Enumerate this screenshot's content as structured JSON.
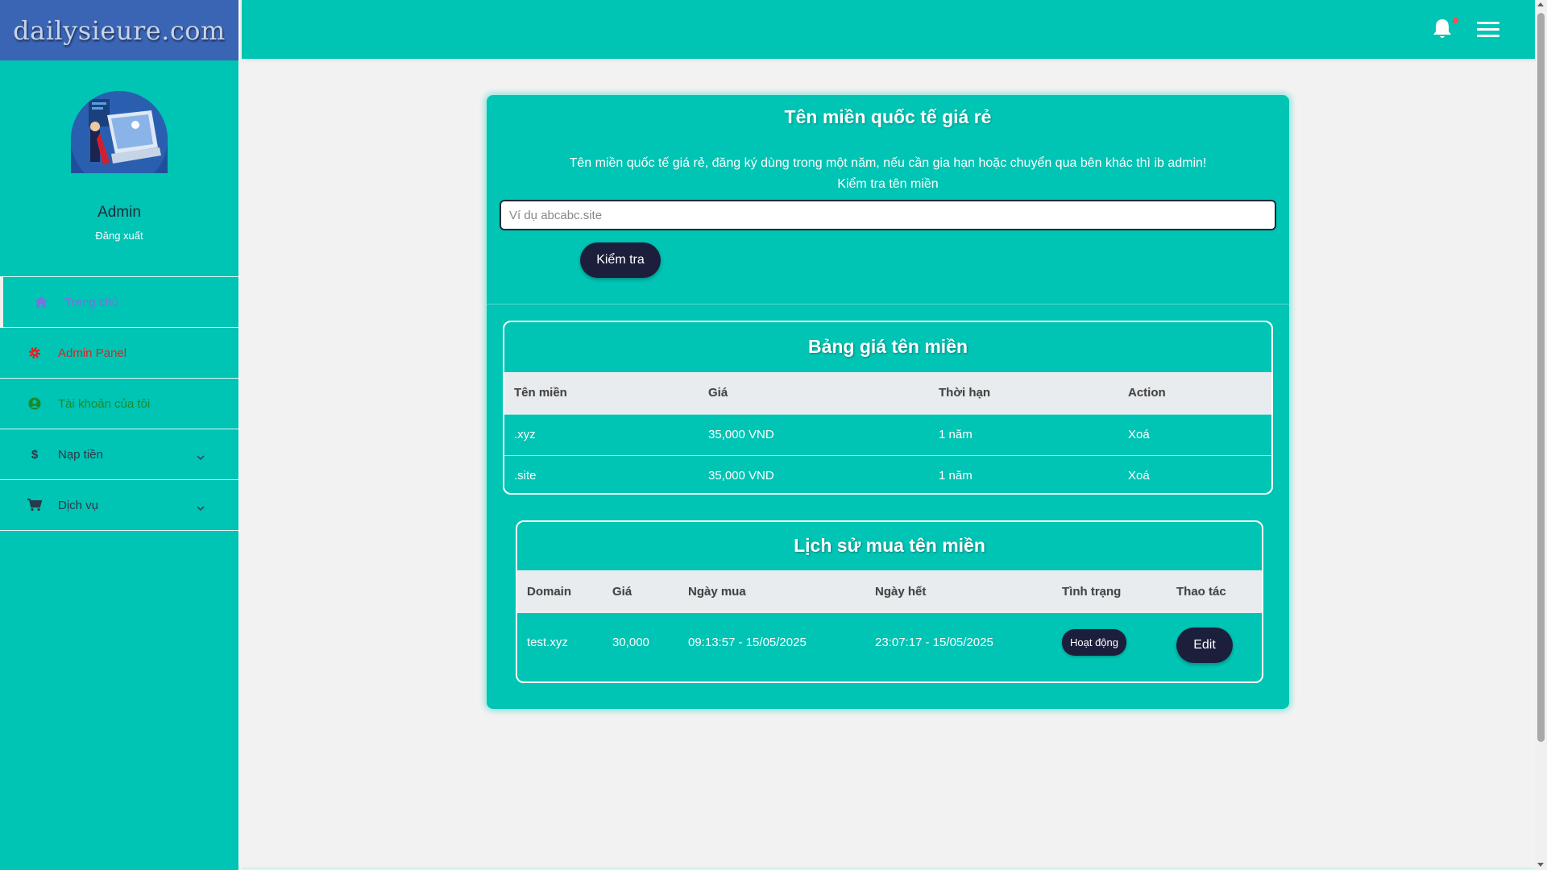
{
  "brand": {
    "name": "dailysieure.com"
  },
  "profile": {
    "name": "Admin",
    "logout_label": "Đăng xuất"
  },
  "sidebar": {
    "items": [
      {
        "label": "Trang chủ",
        "icon": "home-icon",
        "color": "#7c6fe0"
      },
      {
        "label": "Admin Panel",
        "icon": "gear-icon",
        "color": "#e02020"
      },
      {
        "label": "Tài khoản của tôi",
        "icon": "user-circle-icon",
        "color": "#1c8a2a"
      },
      {
        "label": "Nạp tiền",
        "icon": "dollar-icon",
        "color": "#2a3a4a"
      },
      {
        "label": "Dịch vụ",
        "icon": "cart-icon",
        "color": "#2a3a4a"
      }
    ]
  },
  "topbar": {
    "icons": [
      "bell-icon",
      "menu-icon"
    ]
  },
  "main": {
    "title": "Tên miền quốc tế giá rẻ",
    "description": "Tên miền quốc tế giá rẻ, đăng ký dùng trong một năm, nếu cần gia hạn hoặc chuyển qua bên khác thì ib admin!",
    "check_label": "Kiểm tra tên miền",
    "search_placeholder": "Ví dụ abcabc.site",
    "check_button": "Kiểm tra"
  },
  "price_table": {
    "title": "Bảng giá tên miền",
    "headers": [
      "Tên miền",
      "Giá",
      "Thời hạn",
      "Action"
    ],
    "rows": [
      [
        ".xyz",
        "35,000 VND",
        "1 năm",
        "Xoá"
      ],
      [
        ".site",
        "35,000 VND",
        "1 năm",
        "Xoá"
      ]
    ]
  },
  "history_table": {
    "title": "Lịch sử mua tên miền",
    "headers": [
      "Domain",
      "Giá",
      "Ngày mua",
      "Ngày hết",
      "Tình trạng",
      "Thao tác"
    ],
    "rows": [
      {
        "domain": "test.xyz",
        "price": "30,000",
        "bought": "09:13:57 - 15/05/2025",
        "expires": "23:07:17 - 15/05/2025",
        "status": "Hoạt động",
        "action": "Edit"
      }
    ]
  },
  "colors": {
    "primary": "#00c4b4",
    "brand_bg": "#3a64b4",
    "button": "#1c1f3c"
  }
}
